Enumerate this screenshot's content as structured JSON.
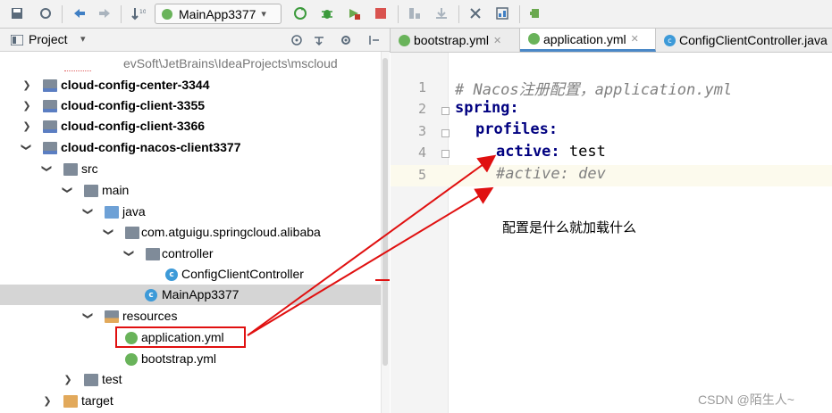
{
  "toolbar": {
    "run_config": "MainApp3377",
    "icons": [
      "save-icon",
      "sync-icon",
      "back-icon",
      "forward-icon",
      "sort-icon",
      "run-icon",
      "debug-icon",
      "coverage-icon",
      "stop-icon",
      "build-icon",
      "deploy-icon",
      "structure-icon",
      "layout-icon",
      "plugin-icon"
    ]
  },
  "project_panel": {
    "title": "Project",
    "path_hint": "evSoft\\JetBrains\\IdeaProjects\\mscloud"
  },
  "tree": [
    {
      "label": "cloud-config-center-3344",
      "bold": true
    },
    {
      "label": "cloud-config-client-3355",
      "bold": true
    },
    {
      "label": "cloud-config-client-3366",
      "bold": true
    },
    {
      "label": "cloud-config-nacos-client3377",
      "bold": true
    },
    {
      "label": "src"
    },
    {
      "label": "main"
    },
    {
      "label": "java"
    },
    {
      "label": "com.atguigu.springcloud.alibaba"
    },
    {
      "label": "controller"
    },
    {
      "label": "ConfigClientController"
    },
    {
      "label": "MainApp3377"
    },
    {
      "label": "resources"
    },
    {
      "label": "application.yml"
    },
    {
      "label": "bootstrap.yml"
    },
    {
      "label": "test"
    },
    {
      "label": "target"
    }
  ],
  "tabs": [
    {
      "label": "bootstrap.yml"
    },
    {
      "label": "application.yml"
    },
    {
      "label": "ConfigClientController.java"
    }
  ],
  "editor": {
    "line_numbers": [
      "1",
      "2",
      "3",
      "4",
      "5"
    ],
    "lines": [
      {
        "comment": "# Nacos注册配置，application.yml"
      },
      {
        "key": "spring:"
      },
      {
        "key": "profiles:"
      },
      {
        "key": "active:",
        "value": " test"
      },
      {
        "comment": "#active: dev"
      }
    ]
  },
  "annotation": "配置是什么就加载什么",
  "watermark": "CSDN @陌生人~",
  "colors": {
    "highlight": "#e01010",
    "yaml_key": "#000080",
    "comment": "#808080",
    "selection": "#d5d5d5"
  }
}
